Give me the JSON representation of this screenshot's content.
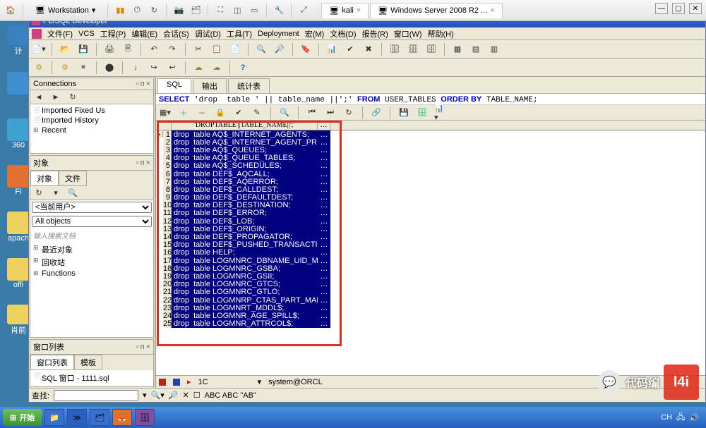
{
  "vm": {
    "workstation_label": "Workstation",
    "tab_kali": "kali",
    "tab_win": "Windows Server 2008 R2 ..."
  },
  "app": {
    "title": "PL/SQL Developer",
    "menus": [
      "文件(F)",
      "VCS",
      "工程(P)",
      "编辑(E)",
      "会话(S)",
      "调试(D)",
      "工具(T)",
      "Deployment",
      "宏(M)",
      "文档(D)",
      "报告(R)",
      "窗口(W)",
      "帮助(H)"
    ]
  },
  "connections": {
    "title": "Connections",
    "items": [
      "Imported Fixed Us",
      "Imported History",
      "Recent"
    ]
  },
  "objects": {
    "title": "对象",
    "tabs": [
      "对象",
      "文件"
    ],
    "current_user": "<当前用户>",
    "all_objects": "All objects",
    "hint": "输入搜索文档",
    "tree": [
      "最近对象",
      "回收站",
      "Functions"
    ]
  },
  "winlist": {
    "title": "窗口列表",
    "tabs": [
      "窗口列表",
      "模板"
    ],
    "item": "SQL 窗口 - 1111.sql"
  },
  "sql": {
    "tabs": [
      "SQL",
      "输出",
      "统计表"
    ],
    "query": "SELECT 'drop  table ' || table_name || ';' FROM USER_TABLES ORDER BY TABLE_NAME;"
  },
  "grid": {
    "headers": [
      "'DROPTABLE'||TABLE_NAME||';'"
    ],
    "rows": [
      "drop  table AQ$_INTERNET_AGENTS;",
      "drop  table AQ$_INTERNET_AGENT_PRIVS;",
      "drop  table AQ$_QUEUES;",
      "drop  table AQ$_QUEUE_TABLES;",
      "drop  table AQ$_SCHEDULES;",
      "drop  table DEF$_AQCALL;",
      "drop  table DEF$_AQERROR;",
      "drop  table DEF$_CALLDEST;",
      "drop  table DEF$_DEFAULTDEST;",
      "drop  table DEF$_DESTINATION;",
      "drop  table DEF$_ERROR;",
      "drop  table DEF$_LOB;",
      "drop  table DEF$_ORIGIN;",
      "drop  table DEF$_PROPAGATOR;",
      "drop  table DEF$_PUSHED_TRANSACTIONS;",
      "drop  table HELP;",
      "drop  table LOGMNRC_DBNAME_UID_MAP;",
      "drop  table LOGMNRC_GSBA;",
      "drop  table LOGMNRC_GSII;",
      "drop  table LOGMNRC_GTCS;",
      "drop  table LOGMNRC_GTLO;",
      "drop  table LOGMNRP_CTAS_PART_MAP;",
      "drop  table LOGMNRT_MDDL$;",
      "drop  table LOGMNR_AGE_SPILL$;",
      "drop  table LOGMNR_ATTRCOL$;"
    ]
  },
  "status": {
    "pos": "1C",
    "conn": "system@ORCL"
  },
  "search": {
    "label": "查找:",
    "options": "ABC ABC \"AB\""
  },
  "taskbar": {
    "start": "开始"
  },
  "watermark": {
    "text": "代码编"
  }
}
